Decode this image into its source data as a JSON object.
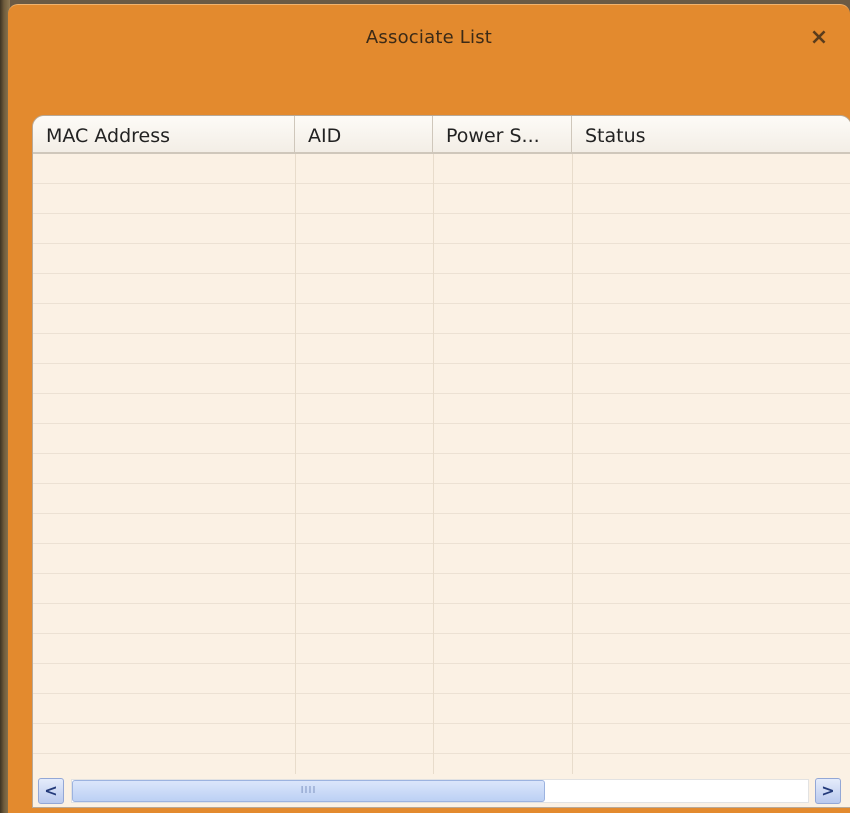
{
  "window": {
    "title": "Associate List",
    "close_label": "×"
  },
  "table": {
    "columns": [
      "MAC Address",
      "AID",
      "Power S...",
      "Status"
    ],
    "rows": []
  },
  "scrollbar": {
    "left_label": "<",
    "right_label": ">",
    "thumb_grip": "IIII"
  }
}
